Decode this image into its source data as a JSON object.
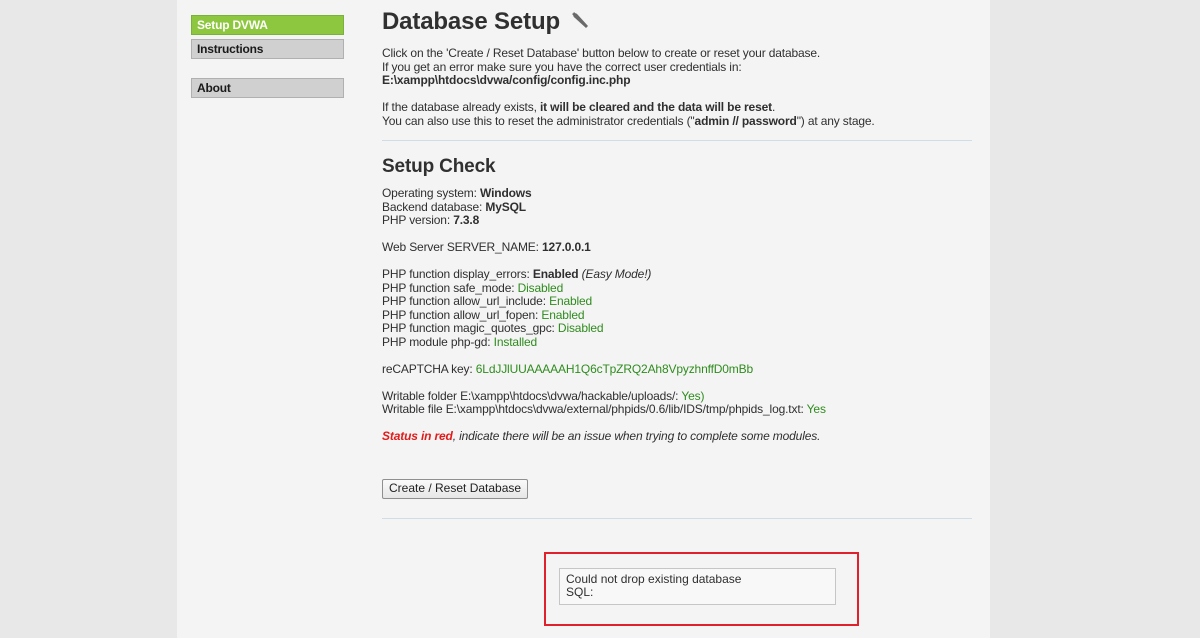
{
  "sidebar": {
    "items": [
      {
        "label": "Setup DVWA",
        "selected": true
      },
      {
        "label": "Instructions",
        "selected": false
      },
      {
        "label": "About",
        "selected": false
      }
    ]
  },
  "header": {
    "title": "Database Setup",
    "title_icon": "wrench-icon"
  },
  "intro": {
    "line1": "Click on the 'Create / Reset Database' button below to create or reset your database.",
    "line2": "If you get an error make sure you have the correct user credentials in:",
    "config_path": "E:\\xampp\\htdocs\\dvwa/config/config.inc.php",
    "exists_prefix": "If the database already exists, ",
    "exists_bold": "it will be cleared and the data will be reset",
    "exists_suffix": ".",
    "reset_prefix": "You can also use this to reset the administrator credentials (\"",
    "reset_bold": "admin // password",
    "reset_suffix": "\") at any stage."
  },
  "setup_check": {
    "title": "Setup Check",
    "os_label": "Operating system: ",
    "os_value": "Windows",
    "db_label": "Backend database: ",
    "db_value": "MySQL",
    "php_label": "PHP version: ",
    "php_value": "7.3.8",
    "server_label": "Web Server SERVER_NAME: ",
    "server_value": "127.0.0.1",
    "display_errors_label": "PHP function display_errors: ",
    "display_errors_value": "Enabled",
    "display_errors_note": "(Easy Mode!)",
    "safe_mode_label": "PHP function safe_mode: ",
    "safe_mode_value": "Disabled",
    "url_include_label": "PHP function allow_url_include: ",
    "url_include_value": "Enabled",
    "url_fopen_label": "PHP function allow_url_fopen: ",
    "url_fopen_value": "Enabled",
    "magic_quotes_label": "PHP function magic_quotes_gpc: ",
    "magic_quotes_value": "Disabled",
    "gd_label": "PHP module php-gd: ",
    "gd_value": "Installed",
    "recaptcha_label": "reCAPTCHA key: ",
    "recaptcha_value": "6LdJJlUUAAAAAH1Q6cTpZRQ2Ah8VpyzhnffD0mBb",
    "folder_label": "Writable folder E:\\xampp\\htdocs\\dvwa/hackable/uploads/: ",
    "folder_value": "Yes)",
    "file_label": "Writable file E:\\xampp\\htdocs\\dvwa/external/phpids/0.6/lib/IDS/tmp/phpids_log.txt: ",
    "file_value": "Yes",
    "status_red": "Status in red",
    "status_note": ", indicate there will be an issue when trying to complete some modules."
  },
  "actions": {
    "create_reset_label": "Create / Reset Database"
  },
  "message": {
    "line1": "Could not drop existing database",
    "line2": "SQL:"
  },
  "colors": {
    "accent_green": "#8dc63f",
    "status_green": "#2f8c1e",
    "status_red": "#e21b1b",
    "highlight_red": "#e0202a"
  }
}
